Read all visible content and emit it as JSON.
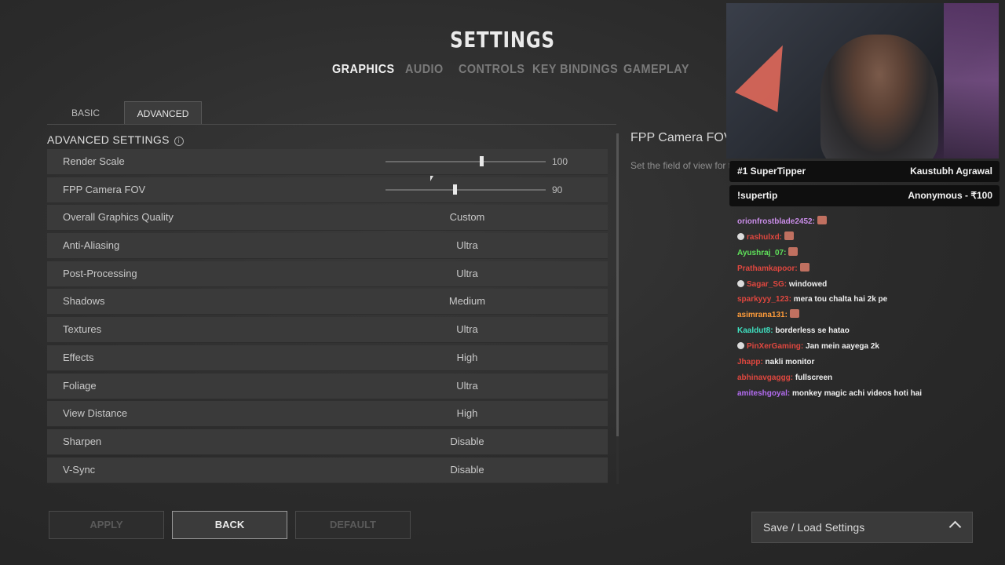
{
  "header": {
    "title": "SETTINGS"
  },
  "main_tabs": [
    {
      "label": "GRAPHICS",
      "active": true
    },
    {
      "label": "AUDIO",
      "active": false
    },
    {
      "label": "CONTROLS",
      "active": false
    },
    {
      "label": "KEY BINDINGS",
      "active": false
    },
    {
      "label": "GAMEPLAY",
      "active": false
    }
  ],
  "sub_tabs": [
    {
      "label": "BASIC",
      "active": false
    },
    {
      "label": "ADVANCED",
      "active": true
    }
  ],
  "section": {
    "title": "ADVANCED SETTINGS",
    "info_icon": "info-icon"
  },
  "settings": [
    {
      "label": "Render Scale",
      "type": "slider",
      "value": "100",
      "level": 0.6
    },
    {
      "label": "FPP Camera FOV",
      "type": "slider",
      "value": "90",
      "level": 0.43
    },
    {
      "label": "Overall Graphics Quality",
      "value": "Custom"
    },
    {
      "label": "Anti-Aliasing",
      "value": "Ultra"
    },
    {
      "label": "Post-Processing",
      "value": "Ultra"
    },
    {
      "label": "Shadows",
      "value": "Medium"
    },
    {
      "label": "Textures",
      "value": "Ultra"
    },
    {
      "label": "Effects",
      "value": "High"
    },
    {
      "label": "Foliage",
      "value": "Ultra"
    },
    {
      "label": "View Distance",
      "value": "High"
    },
    {
      "label": "Sharpen",
      "value": "Disable"
    },
    {
      "label": "V-Sync",
      "value": "Disable"
    }
  ],
  "description": {
    "title": "FPP Camera FOV",
    "text": "Set the field of view for the first person perspective camera."
  },
  "buttons": {
    "apply": "APPLY",
    "back": "BACK",
    "default": "DEFAULT"
  },
  "save_load": {
    "label": "Save / Load Settings",
    "icon": "chevron-up-icon"
  },
  "stream": {
    "tips": [
      {
        "left": "#1 SuperTipper",
        "right": "Kaustubh Agrawal"
      },
      {
        "left": "!supertip",
        "right": "Anonymous - ₹100"
      }
    ],
    "chat": [
      {
        "user": "orionfrostblade2452:",
        "color": "#c98de8",
        "text": "",
        "emote": true
      },
      {
        "user": "rashulxd:",
        "color": "#e0473f",
        "text": "",
        "emote": true,
        "badge": true
      },
      {
        "user": "Ayushraj_07:",
        "color": "#5fe05a",
        "text": "",
        "emote": true
      },
      {
        "user": "Prathamkapoor:",
        "color": "#e0473f",
        "text": "",
        "emote": true
      },
      {
        "user": "Sagar_SG:",
        "color": "#e0473f",
        "text": "windowed",
        "badge": true
      },
      {
        "user": "sparkyyy_123:",
        "color": "#e0473f",
        "text": "mera tou chalta hai 2k pe"
      },
      {
        "user": "asimrana131:",
        "color": "#ff9c3a",
        "text": "",
        "emote": true
      },
      {
        "user": "Kaaldut8:",
        "color": "#3fe0c0",
        "text": "borderless se hatao"
      },
      {
        "user": "PinXerGaming:",
        "color": "#e0473f",
        "text": "Jan mein aayega 2k",
        "badge": true
      },
      {
        "user": "Jhapp:",
        "color": "#e0473f",
        "text": "nakli monitor"
      },
      {
        "user": "abhinavgaggg:",
        "color": "#e0473f",
        "text": "fullscreen"
      },
      {
        "user": "amiteshgoyal:",
        "color": "#b36cf0",
        "text": "monkey magic achi videos hoti hai"
      }
    ]
  }
}
